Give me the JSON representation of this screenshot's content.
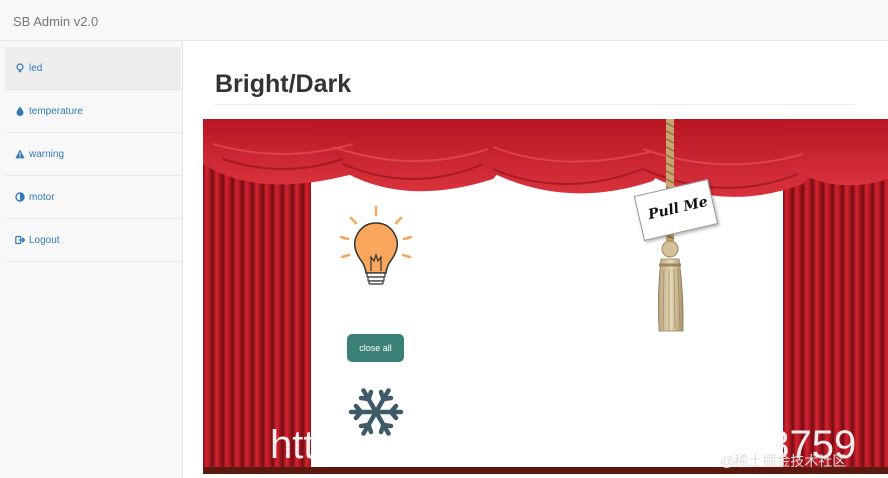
{
  "header": {
    "brand": "SB Admin v2.0"
  },
  "sidebar": {
    "items": [
      {
        "label": "led",
        "icon": "lightbulb-icon",
        "active": true
      },
      {
        "label": "temperature",
        "icon": "tint-icon",
        "active": false
      },
      {
        "label": "warning",
        "icon": "warning-icon",
        "active": false
      },
      {
        "label": "motor",
        "icon": "adjust-icon",
        "active": false
      },
      {
        "label": "Logout",
        "icon": "sign-out-icon",
        "active": false
      }
    ]
  },
  "main": {
    "title": "Bright/Dark",
    "stage": {
      "close_button": "close all",
      "pull_card": "Pull Me",
      "icons": [
        "lightbulb-icon",
        "snowflake-icon",
        "curtain",
        "rope-tassel"
      ]
    }
  },
  "watermark": {
    "left": "htt",
    "right": "68759",
    "site": "@稀土掘金技术社区"
  },
  "colors": {
    "accent": "#3a8076",
    "link": "#337ab7",
    "curtain": "#c21f2a",
    "bulb": "#f7a65b",
    "snowflake": "#3d5a66"
  }
}
